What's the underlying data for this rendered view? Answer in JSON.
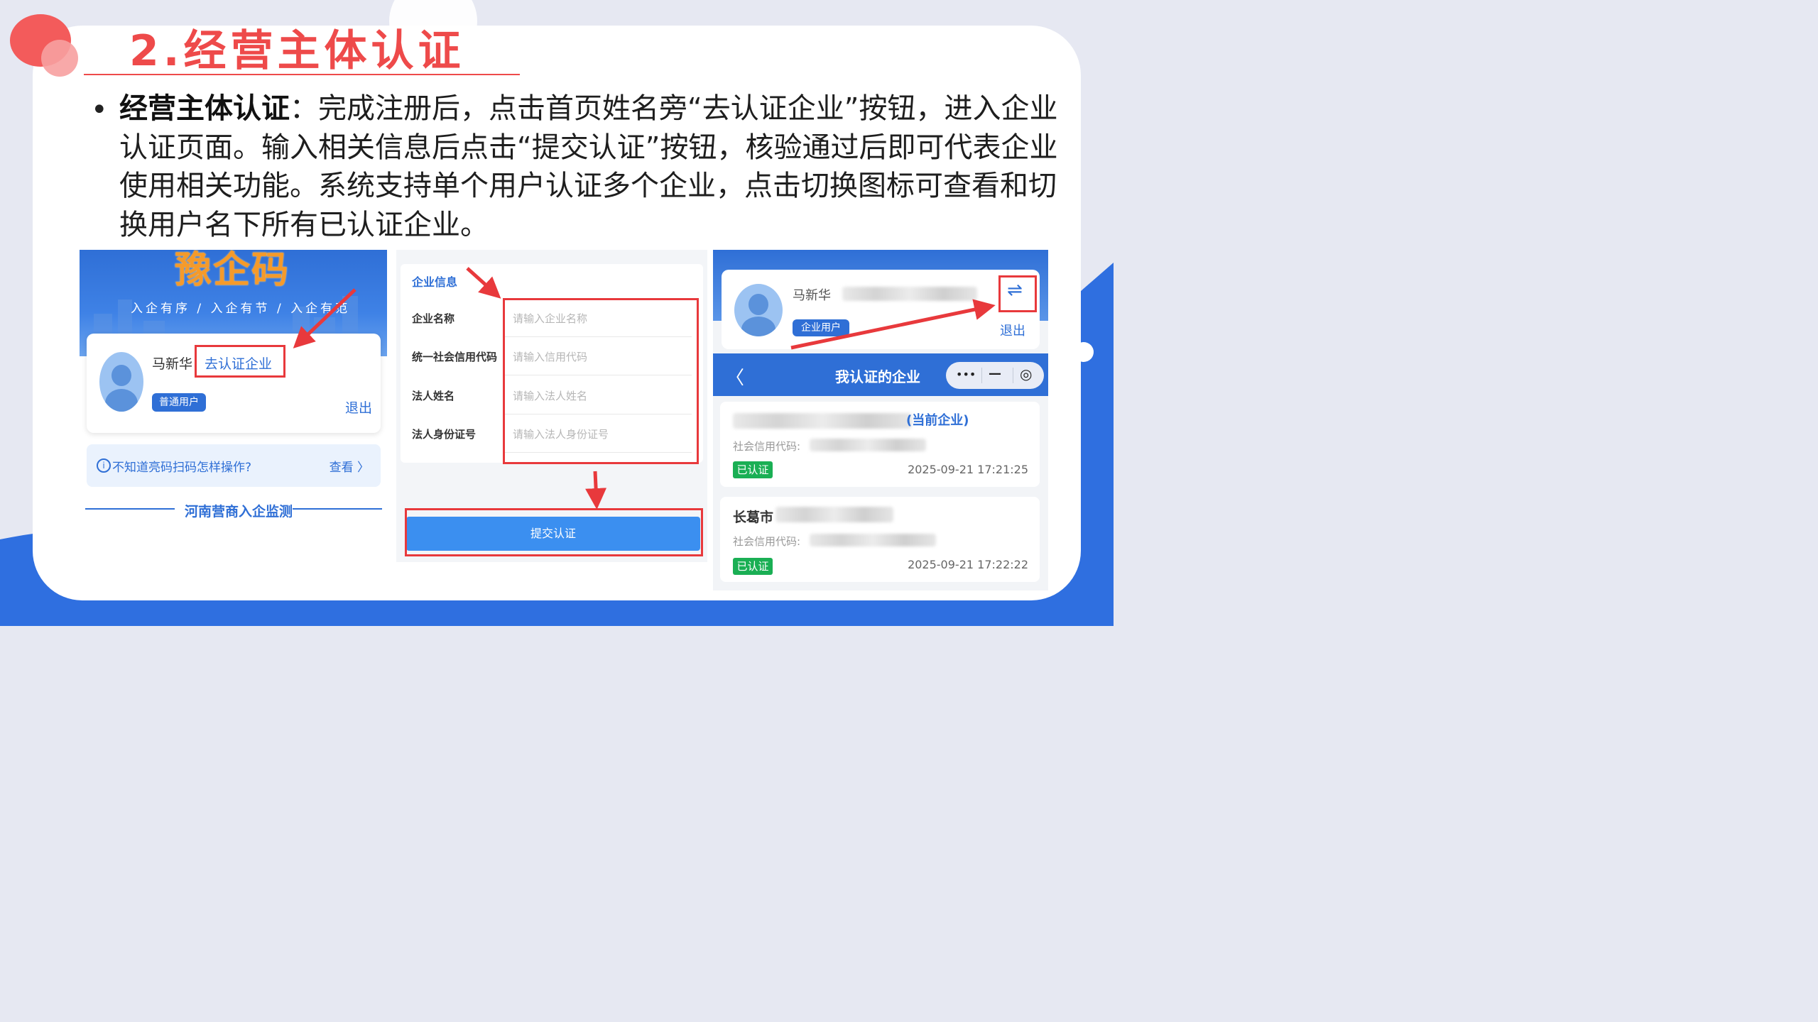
{
  "colors": {
    "accent_red": "#ee4a4a",
    "brand_blue": "#2f6fd6",
    "verified_green": "#1aaf54"
  },
  "slide": {
    "title": "2.经营主体认证",
    "bullet_symbol": "•",
    "lead": "经营主体认证",
    "body": "：完成注册后，点击首页姓名旁“去认证企业”按钮，进入企业认证页面。输入相关信息后点击“提交认证”按钮，核验通过后即可代表企业使用相关功能。系统支持单个用户认证多个企业，点击切换图标可查看和切换用户名下所有已认证企业。"
  },
  "panel1": {
    "logo": "豫企码",
    "slogan": "入企有序 / 入企有节 / 入企有范",
    "user_name": "马新华",
    "certify_button": "去认证企业",
    "role_badge": "普通用户",
    "logout": "退出",
    "tip_icon": "info-icon",
    "tip_text": "不知道亮码扫码怎样操作?",
    "tip_view": "查看 〉",
    "footer": "河南营商入企监测"
  },
  "panel2": {
    "section_title": "企业信息",
    "fields": [
      {
        "label": "企业名称",
        "placeholder": "请输入企业名称"
      },
      {
        "label": "统一社会信用代码",
        "placeholder": "请输入信用代码"
      },
      {
        "label": "法人姓名",
        "placeholder": "请输入法人姓名"
      },
      {
        "label": "法人身份证号",
        "placeholder": "请输入法人身份证号"
      }
    ],
    "submit": "提交认证"
  },
  "panel3": {
    "user_name": "马新华",
    "switch_icon": "⇌",
    "role_badge": "企业用户",
    "logout": "退出",
    "nav_back": "〈",
    "nav_title": "我认证的企业",
    "capsule_more": "•••",
    "capsule_min": "—",
    "capsule_close": "◎",
    "enterprises": [
      {
        "name_prefix": "",
        "current_tag": "(当前企业)",
        "code_label": "社会信用代码:",
        "status": "已认证",
        "time": "2025-09-21 17:21:25"
      },
      {
        "name_prefix": "长葛市",
        "current_tag": "",
        "code_label": "社会信用代码:",
        "status": "已认证",
        "time": "2025-09-21 17:22:22"
      }
    ]
  }
}
